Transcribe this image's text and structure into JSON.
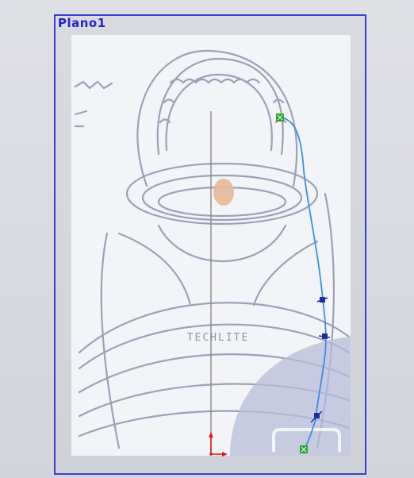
{
  "sketch_plane": {
    "label": "Plano1"
  },
  "reference_image": {
    "brand_text": "TECHLITE"
  },
  "colors": {
    "plane_border": "#3a3fd0",
    "plane_label": "#1f26c8",
    "spline": "#3e8ee6",
    "endpoint": "#2aa52a",
    "control_point": "#1f2ea8",
    "centerline": "#8a8a8a",
    "origin_red": "#e01818"
  },
  "icons": {
    "origin": "origin-icon",
    "endpoint": "endpoint-handle-icon",
    "control_point": "spline-control-point-icon"
  }
}
